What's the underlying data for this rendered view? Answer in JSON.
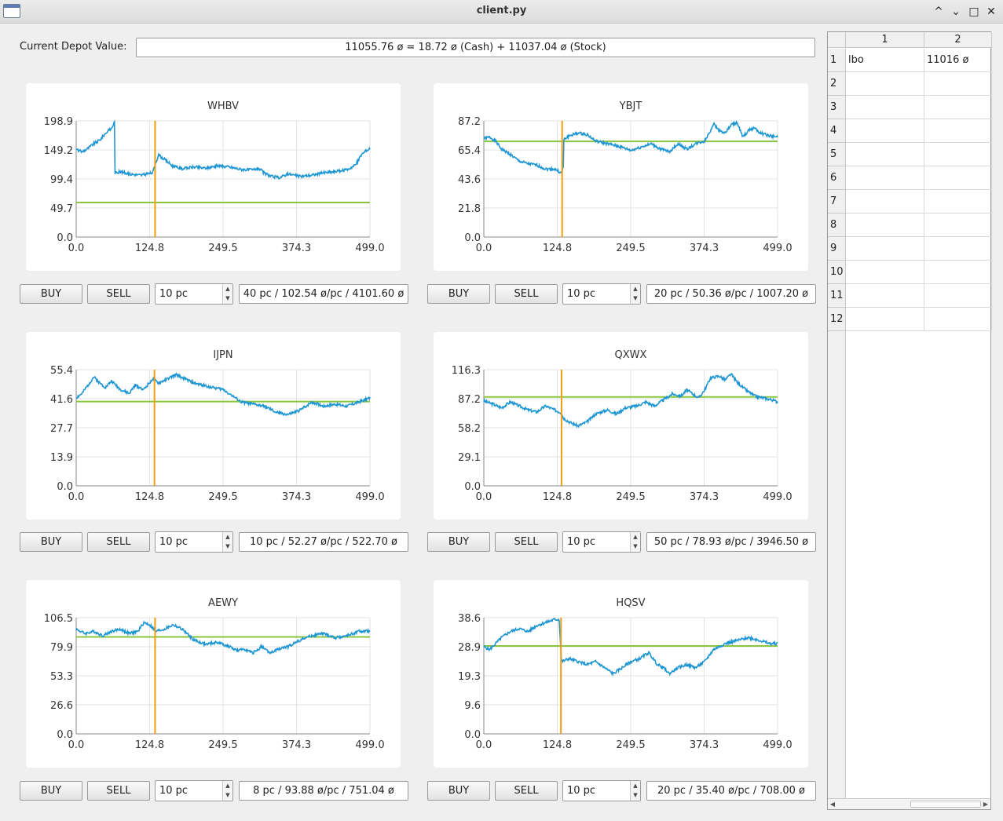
{
  "window": {
    "title": "client.py",
    "controls": {
      "minimize": "⌄",
      "restore": "^",
      "maximize": "□",
      "close": "✕"
    }
  },
  "depot": {
    "label": "Current Depot Value:",
    "value": "11055.76 ø = 18.72 ø (Cash) + 11037.04 ø (Stock)"
  },
  "colors": {
    "price_line": "#1f96d4",
    "avg_line": "#8cc63f",
    "marker_line": "#f39c12",
    "grid": "#e3e3e3",
    "axis": "#888888"
  },
  "stocks": [
    {
      "symbol": "WHBV",
      "buy_label": "BUY",
      "sell_label": "SELL",
      "quantity": "10 pc",
      "position": "40 pc / 102.54 ø/pc / 4101.60 ø",
      "chart_data": {
        "type": "line",
        "title": "WHBV",
        "xlim": [
          0,
          499
        ],
        "ylim": [
          0,
          198.9
        ],
        "x_ticks": [
          "0.0",
          "124.8",
          "249.5",
          "374.3",
          "499.0"
        ],
        "y_ticks": [
          "0.0",
          "49.7",
          "99.4",
          "149.2",
          "198.9"
        ],
        "buy_in_price": 59.2,
        "marker_x": 134,
        "price_keypoints": [
          [
            0,
            150
          ],
          [
            10,
            146
          ],
          [
            20,
            152
          ],
          [
            30,
            160
          ],
          [
            40,
            166
          ],
          [
            50,
            178
          ],
          [
            60,
            186
          ],
          [
            65,
            197
          ],
          [
            66,
            110
          ],
          [
            75,
            112
          ],
          [
            90,
            108
          ],
          [
            110,
            106
          ],
          [
            130,
            110
          ],
          [
            135,
            128
          ],
          [
            140,
            140
          ],
          [
            150,
            133
          ],
          [
            165,
            121
          ],
          [
            180,
            117
          ],
          [
            200,
            120
          ],
          [
            220,
            118
          ],
          [
            240,
            122
          ],
          [
            260,
            120
          ],
          [
            280,
            116
          ],
          [
            300,
            115
          ],
          [
            310,
            118
          ],
          [
            320,
            109
          ],
          [
            330,
            104
          ],
          [
            345,
            102
          ],
          [
            360,
            108
          ],
          [
            380,
            104
          ],
          [
            400,
            106
          ],
          [
            420,
            110
          ],
          [
            440,
            112
          ],
          [
            460,
            115
          ],
          [
            475,
            124
          ],
          [
            485,
            142
          ],
          [
            499,
            152
          ]
        ]
      }
    },
    {
      "symbol": "YBJT",
      "buy_label": "BUY",
      "sell_label": "SELL",
      "quantity": "10 pc",
      "position": "20 pc / 50.36 ø/pc / 1007.20 ø",
      "chart_data": {
        "type": "line",
        "title": "YBJT",
        "xlim": [
          0,
          499
        ],
        "ylim": [
          0,
          87.2
        ],
        "x_ticks": [
          "0.0",
          "124.8",
          "249.5",
          "374.3",
          "499.0"
        ],
        "y_ticks": [
          "0.0",
          "21.8",
          "43.6",
          "65.4",
          "87.2"
        ],
        "buy_in_price": 71.8,
        "marker_x": 133,
        "price_keypoints": [
          [
            0,
            74
          ],
          [
            10,
            75
          ],
          [
            20,
            72
          ],
          [
            30,
            66
          ],
          [
            45,
            62
          ],
          [
            60,
            57
          ],
          [
            75,
            55
          ],
          [
            90,
            54
          ],
          [
            105,
            51
          ],
          [
            120,
            51
          ],
          [
            132,
            48
          ],
          [
            134,
            52
          ],
          [
            136,
            73
          ],
          [
            145,
            76
          ],
          [
            160,
            78
          ],
          [
            175,
            77
          ],
          [
            190,
            72
          ],
          [
            210,
            70
          ],
          [
            230,
            68
          ],
          [
            250,
            65
          ],
          [
            270,
            68
          ],
          [
            285,
            70
          ],
          [
            300,
            66
          ],
          [
            315,
            64
          ],
          [
            330,
            70
          ],
          [
            345,
            66
          ],
          [
            360,
            70
          ],
          [
            375,
            72
          ],
          [
            385,
            80
          ],
          [
            390,
            85
          ],
          [
            400,
            80
          ],
          [
            410,
            78
          ],
          [
            420,
            84
          ],
          [
            430,
            86
          ],
          [
            440,
            75
          ],
          [
            450,
            80
          ],
          [
            460,
            82
          ],
          [
            470,
            78
          ],
          [
            485,
            76
          ],
          [
            499,
            75
          ]
        ]
      }
    },
    {
      "symbol": "IJPN",
      "buy_label": "BUY",
      "sell_label": "SELL",
      "quantity": "10 pc",
      "position": "10 pc / 52.27 ø/pc / 522.70 ø",
      "chart_data": {
        "type": "line",
        "title": "IJPN",
        "xlim": [
          0,
          499
        ],
        "ylim": [
          0,
          55.4
        ],
        "x_ticks": [
          "0.0",
          "124.8",
          "249.5",
          "374.3",
          "499.0"
        ],
        "y_ticks": [
          "0.0",
          "13.9",
          "27.7",
          "41.6",
          "55.4"
        ],
        "buy_in_price": 40.2,
        "marker_x": 133,
        "price_keypoints": [
          [
            0,
            42
          ],
          [
            10,
            44
          ],
          [
            20,
            48
          ],
          [
            30,
            52
          ],
          [
            40,
            49
          ],
          [
            50,
            47
          ],
          [
            60,
            50
          ],
          [
            75,
            46
          ],
          [
            90,
            44
          ],
          [
            100,
            48
          ],
          [
            115,
            46
          ],
          [
            130,
            51
          ],
          [
            140,
            49
          ],
          [
            155,
            51
          ],
          [
            170,
            53
          ],
          [
            185,
            51
          ],
          [
            200,
            49
          ],
          [
            215,
            48
          ],
          [
            230,
            47
          ],
          [
            250,
            46
          ],
          [
            265,
            43
          ],
          [
            280,
            40
          ],
          [
            300,
            39
          ],
          [
            320,
            38
          ],
          [
            340,
            35
          ],
          [
            360,
            34
          ],
          [
            380,
            36
          ],
          [
            400,
            40
          ],
          [
            420,
            38
          ],
          [
            440,
            39
          ],
          [
            460,
            38
          ],
          [
            480,
            40
          ],
          [
            499,
            42
          ]
        ]
      }
    },
    {
      "symbol": "QXWX",
      "buy_label": "BUY",
      "sell_label": "SELL",
      "quantity": "10 pc",
      "position": "50 pc / 78.93 ø/pc / 3946.50 ø",
      "chart_data": {
        "type": "line",
        "title": "QXWX",
        "xlim": [
          0,
          499
        ],
        "ylim": [
          0,
          116.3
        ],
        "x_ticks": [
          "0.0",
          "124.8",
          "249.5",
          "374.3",
          "499.0"
        ],
        "y_ticks": [
          "0.0",
          "29.1",
          "58.2",
          "87.2",
          "116.3"
        ],
        "buy_in_price": 89.0,
        "marker_x": 132,
        "price_keypoints": [
          [
            0,
            85
          ],
          [
            15,
            82
          ],
          [
            30,
            78
          ],
          [
            45,
            84
          ],
          [
            60,
            80
          ],
          [
            75,
            76
          ],
          [
            90,
            74
          ],
          [
            105,
            80
          ],
          [
            120,
            76
          ],
          [
            132,
            73
          ],
          [
            135,
            68
          ],
          [
            145,
            64
          ],
          [
            160,
            60
          ],
          [
            175,
            64
          ],
          [
            190,
            72
          ],
          [
            210,
            76
          ],
          [
            225,
            72
          ],
          [
            240,
            78
          ],
          [
            260,
            80
          ],
          [
            275,
            84
          ],
          [
            290,
            80
          ],
          [
            305,
            86
          ],
          [
            320,
            92
          ],
          [
            335,
            90
          ],
          [
            345,
            96
          ],
          [
            355,
            92
          ],
          [
            365,
            88
          ],
          [
            375,
            96
          ],
          [
            385,
            108
          ],
          [
            400,
            110
          ],
          [
            410,
            106
          ],
          [
            420,
            112
          ],
          [
            430,
            104
          ],
          [
            445,
            96
          ],
          [
            460,
            90
          ],
          [
            475,
            88
          ],
          [
            490,
            86
          ],
          [
            499,
            84
          ]
        ]
      }
    },
    {
      "symbol": "AEWY",
      "buy_label": "BUY",
      "sell_label": "SELL",
      "quantity": "10 pc",
      "position": "8 pc / 93.88 ø/pc / 751.04 ø",
      "chart_data": {
        "type": "line",
        "title": "AEWY",
        "xlim": [
          0,
          499
        ],
        "ylim": [
          0,
          106.5
        ],
        "x_ticks": [
          "0.0",
          "124.8",
          "249.5",
          "374.3",
          "499.0"
        ],
        "y_ticks": [
          "0.0",
          "26.6",
          "53.3",
          "79.9",
          "106.5"
        ],
        "buy_in_price": 88.9,
        "marker_x": 134,
        "price_keypoints": [
          [
            0,
            96
          ],
          [
            15,
            92
          ],
          [
            30,
            94
          ],
          [
            45,
            90
          ],
          [
            60,
            94
          ],
          [
            75,
            96
          ],
          [
            90,
            92
          ],
          [
            105,
            94
          ],
          [
            115,
            102
          ],
          [
            125,
            100
          ],
          [
            135,
            94
          ],
          [
            150,
            96
          ],
          [
            165,
            100
          ],
          [
            180,
            96
          ],
          [
            200,
            86
          ],
          [
            220,
            82
          ],
          [
            240,
            84
          ],
          [
            260,
            80
          ],
          [
            275,
            76
          ],
          [
            285,
            78
          ],
          [
            300,
            74
          ],
          [
            315,
            80
          ],
          [
            330,
            74
          ],
          [
            345,
            78
          ],
          [
            360,
            80
          ],
          [
            380,
            86
          ],
          [
            400,
            90
          ],
          [
            420,
            92
          ],
          [
            440,
            88
          ],
          [
            460,
            90
          ],
          [
            480,
            94
          ],
          [
            499,
            94
          ]
        ]
      }
    },
    {
      "symbol": "HQSV",
      "buy_label": "BUY",
      "sell_label": "SELL",
      "quantity": "10 pc",
      "position": "20 pc / 35.40 ø/pc / 708.00 ø",
      "chart_data": {
        "type": "line",
        "title": "HQSV",
        "xlim": [
          0,
          499
        ],
        "ylim": [
          0,
          38.6
        ],
        "x_ticks": [
          "0.0",
          "124.8",
          "249.5",
          "374.3",
          "499.0"
        ],
        "y_ticks": [
          "0.0",
          "9.6",
          "19.3",
          "28.9",
          "38.6"
        ],
        "buy_in_price": 29.2,
        "marker_x": 131,
        "price_keypoints": [
          [
            0,
            29
          ],
          [
            10,
            28
          ],
          [
            20,
            30
          ],
          [
            30,
            32
          ],
          [
            45,
            34
          ],
          [
            60,
            35
          ],
          [
            75,
            34
          ],
          [
            90,
            36
          ],
          [
            105,
            37
          ],
          [
            120,
            38
          ],
          [
            128,
            38
          ],
          [
            132,
            24
          ],
          [
            145,
            25
          ],
          [
            160,
            24
          ],
          [
            175,
            23
          ],
          [
            190,
            24
          ],
          [
            205,
            22
          ],
          [
            220,
            20
          ],
          [
            235,
            22
          ],
          [
            250,
            24
          ],
          [
            265,
            25
          ],
          [
            280,
            27
          ],
          [
            295,
            23
          ],
          [
            305,
            22
          ],
          [
            315,
            20
          ],
          [
            330,
            22
          ],
          [
            345,
            23
          ],
          [
            360,
            22
          ],
          [
            375,
            24
          ],
          [
            390,
            28
          ],
          [
            410,
            30
          ],
          [
            430,
            31
          ],
          [
            450,
            32
          ],
          [
            470,
            31
          ],
          [
            485,
            30
          ],
          [
            499,
            30
          ]
        ]
      }
    }
  ],
  "table": {
    "columns": [
      "1",
      "2"
    ],
    "rows": [
      "1",
      "2",
      "3",
      "4",
      "5",
      "6",
      "7",
      "8",
      "9",
      "10",
      "11",
      "12"
    ],
    "cells": [
      [
        "lbo",
        "11016 ø"
      ]
    ]
  },
  "scrollbar": {
    "left_arrow": "◀",
    "right_arrow": "▶"
  }
}
